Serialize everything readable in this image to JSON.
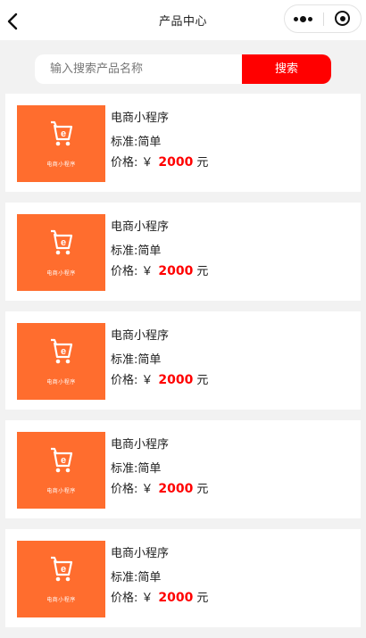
{
  "navbar": {
    "title": "产品中心",
    "back_icon": "chevron-left-icon",
    "more_icon": "more-dots-icon",
    "close_icon": "target-circle-icon"
  },
  "search": {
    "placeholder": "输入搜索产品名称",
    "button_label": "搜索",
    "button_color": "#ff0000"
  },
  "products": [
    {
      "thumb_caption": "电商小程序",
      "name": "电商小程序",
      "spec_label": "标准:",
      "spec_value": "简单",
      "price_label": "价格:",
      "currency": "￥",
      "price": "2000",
      "unit": "元"
    },
    {
      "thumb_caption": "电商小程序",
      "name": "电商小程序",
      "spec_label": "标准:",
      "spec_value": "简单",
      "price_label": "价格:",
      "currency": "￥",
      "price": "2000",
      "unit": "元"
    },
    {
      "thumb_caption": "电商小程序",
      "name": "电商小程序",
      "spec_label": "标准:",
      "spec_value": "简单",
      "price_label": "价格:",
      "currency": "￥",
      "price": "2000",
      "unit": "元"
    },
    {
      "thumb_caption": "电商小程序",
      "name": "电商小程序",
      "spec_label": "标准:",
      "spec_value": "简单",
      "price_label": "价格:",
      "currency": "￥",
      "price": "2000",
      "unit": "元"
    },
    {
      "thumb_caption": "电商小程序",
      "name": "电商小程序",
      "spec_label": "标准:",
      "spec_value": "简单",
      "price_label": "价格:",
      "currency": "￥",
      "price": "2000",
      "unit": "元"
    }
  ],
  "colors": {
    "thumb_bg": "#ff6d2e",
    "price_color": "#ff0000",
    "page_bg": "#f2f2f2"
  }
}
